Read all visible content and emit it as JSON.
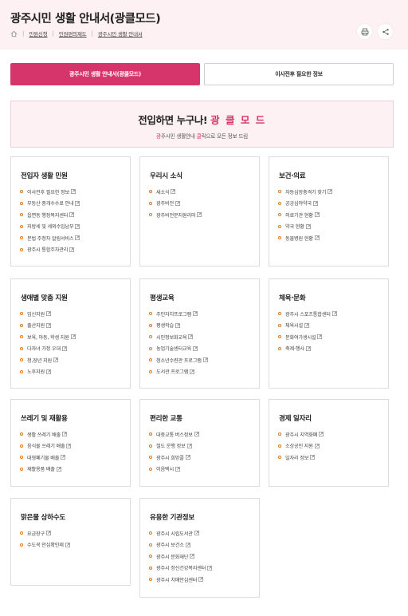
{
  "page": {
    "title": "광주시민 생활 안내서(광클모드)"
  },
  "breadcrumb": [
    "민원신청",
    "민원편의제도",
    "광주시민 생활 안내서"
  ],
  "mode_tabs": {
    "active": "광주시민 생활 안내서(광클모드)",
    "inactive": "이사전후 필요한 정보"
  },
  "hero": {
    "title_prefix": "전입하면 누구나!",
    "title_accent": "광 클 모 드",
    "sub_1": "광",
    "sub_2": "주시민 생활안내 ",
    "sub_3": "클",
    "sub_4": "릭으로 모든 정보 드림"
  },
  "cards": [
    {
      "title": "전입자 생활 민원",
      "items": [
        "이사전후 필요한 정보",
        "부동산 중개수수료 안내",
        "읍면동 행정복지센터",
        "지방세 및 세외수입납부",
        "분법 주정차 알림서비스",
        "광주시 통합주차관리"
      ]
    },
    {
      "title": "우리시 소식",
      "items": [
        "새소식",
        "광주비전",
        "광주비전문지원리미"
      ]
    },
    {
      "title": "보건·의료",
      "items": [
        "자동심장충격기 찾기",
        "공공심야약국",
        "의료기관 현황",
        "약국 현황",
        "동물병원 현황"
      ]
    },
    {
      "title": "생애별 맞춤 지원",
      "items": [
        "임신지원",
        "출산지원",
        "보육, 아동, 학생 지원",
        "다자녀 가정 우대",
        "청,장년 지원",
        "노후지원"
      ]
    },
    {
      "title": "평생교육",
      "items": [
        "주민자치프로그램",
        "평생학습",
        "시민정보화교육",
        "농업기술센터교육",
        "청소년수련관 프로그램",
        "도서관 프로그램"
      ]
    },
    {
      "title": "체육·문화",
      "items": [
        "광주시 스포츠통합센터",
        "체육시설",
        "문화여가생시설",
        "축제·행사"
      ]
    },
    {
      "title": "쓰레기 및 재활용",
      "items": [
        "생활 쓰레기 배출",
        "음식물 쓰레기 배출",
        "대형폐기물 배출",
        "재활용품 배출"
      ]
    },
    {
      "title": "편리한 교통",
      "items": [
        "대중교통 버스정보",
        "철도 운행 정보",
        "광주시 희망콜",
        "이음택시"
      ]
    },
    {
      "title": "경제 일자리",
      "items": [
        "광주시 지역화폐",
        "소상공인 지원",
        "일자리 정보"
      ]
    },
    {
      "title": "맑은물 상하수도",
      "items": [
        "요금장구",
        "수도꼭 안심확인제"
      ]
    },
    {
      "title": "유용한 기관정보",
      "items": [
        "광주시 시립도서관",
        "광주시 보건소",
        "광주시 문화재단",
        "광주시 정신건강복지센터",
        "광주시 치매안심센터"
      ]
    }
  ],
  "colors": {
    "accent": "#d6356b",
    "bullet": "#e07a1e",
    "hero_bg": "#fdf1f3",
    "card_border": "#dcdcdc"
  },
  "icons": {
    "home": "home-icon",
    "print": "print-icon",
    "share": "share-icon",
    "external": "external-link-icon"
  }
}
